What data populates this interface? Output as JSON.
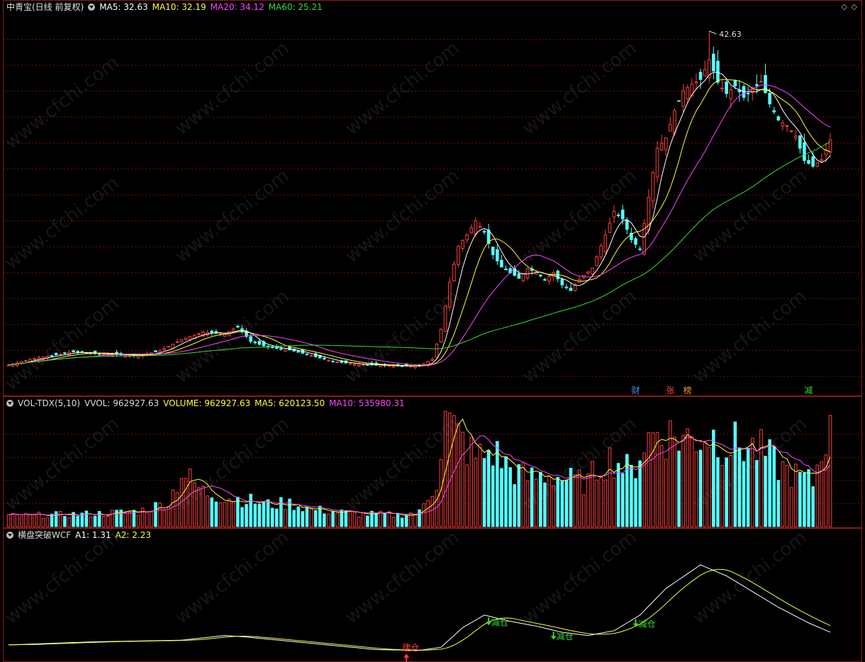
{
  "main": {
    "title": "中青宝(日线 前复权)",
    "ma5": {
      "label": "MA5: 32.63",
      "color": "#ffffff"
    },
    "ma10": {
      "label": "MA10: 32.19",
      "color": "#ffff33"
    },
    "ma20": {
      "label": "MA20: 34.12",
      "color": "#ff44ff"
    },
    "ma60": {
      "label": "MA60: 25.21",
      "color": "#33dd33"
    },
    "high_label": "42.63",
    "price_range": [
      6.0,
      44.5
    ],
    "events": [
      {
        "text": "财",
        "idx": 145,
        "color": "#4d8fff"
      },
      {
        "text": "张",
        "idx": 153,
        "color": "#ff4040"
      },
      {
        "text": "榜",
        "idx": 157,
        "color": "#e0a020"
      },
      {
        "text": "减",
        "idx": 185,
        "color": "#33dd33"
      }
    ]
  },
  "volume": {
    "title": "VOL-TDX(5,10)",
    "vvol": "VVOL: 962927.63",
    "volume": {
      "label": "VOLUME: 962927.63",
      "color": "#ffff33"
    },
    "ma5": {
      "label": "MA5: 620123.50",
      "color": "#ffff33"
    },
    "ma10": {
      "label": "MA10: 535980.31",
      "color": "#ff44ff"
    },
    "max": 1000000
  },
  "indicator": {
    "title": "横盘突破WCF",
    "a1": {
      "label": "A1: 1.31",
      "color": "#ffffff"
    },
    "a2": {
      "label": "A2: 2.23",
      "color": "#ffff33"
    },
    "signals": [
      {
        "text": "建仓",
        "idx": 92,
        "type": "buy"
      },
      {
        "text": "减仓",
        "idx": 111,
        "type": "sell"
      },
      {
        "text": "减仓",
        "idx": 126,
        "type": "sell"
      },
      {
        "text": "减仓",
        "idx": 145,
        "type": "sell"
      }
    ]
  },
  "watermark": "www.cfchi.com",
  "colors": {
    "up": "#ff3d3d",
    "down": "#54ffff",
    "grid": "#6e1010",
    "frame": "#8b1a1a"
  },
  "chart_data": {
    "type": "candlestick",
    "num_bars": 191,
    "anchors": [
      [
        0,
        7.2
      ],
      [
        5,
        7.8
      ],
      [
        10,
        8.2
      ],
      [
        15,
        8.6
      ],
      [
        20,
        8.4
      ],
      [
        25,
        8.3
      ],
      [
        30,
        8.2
      ],
      [
        35,
        8.7
      ],
      [
        40,
        9.9
      ],
      [
        45,
        10.7
      ],
      [
        50,
        10.5
      ],
      [
        53,
        11.3
      ],
      [
        56,
        9.7
      ],
      [
        60,
        9.1
      ],
      [
        65,
        8.8
      ],
      [
        70,
        8.2
      ],
      [
        75,
        7.6
      ],
      [
        80,
        7.3
      ],
      [
        85,
        7.2
      ],
      [
        90,
        7.1
      ],
      [
        95,
        7.1
      ],
      [
        98,
        7.8
      ],
      [
        100,
        11.0
      ],
      [
        102,
        16.0
      ],
      [
        104,
        19.8
      ],
      [
        106,
        21.0
      ],
      [
        108,
        22.5
      ],
      [
        110,
        21.3
      ],
      [
        112,
        18.9
      ],
      [
        114,
        17.6
      ],
      [
        116,
        17.0
      ],
      [
        118,
        16.4
      ],
      [
        120,
        17.4
      ],
      [
        122,
        17.1
      ],
      [
        124,
        16.2
      ],
      [
        126,
        17.0
      ],
      [
        128,
        15.7
      ],
      [
        130,
        15.1
      ],
      [
        132,
        16.3
      ],
      [
        135,
        17.5
      ],
      [
        138,
        21.0
      ],
      [
        140,
        23.5
      ],
      [
        142,
        22.7
      ],
      [
        144,
        20.5
      ],
      [
        146,
        19.5
      ],
      [
        148,
        25.0
      ],
      [
        150,
        30.2
      ],
      [
        152,
        31.3
      ],
      [
        154,
        34.2
      ],
      [
        156,
        36.3
      ],
      [
        158,
        37.0
      ],
      [
        160,
        37.5
      ],
      [
        162,
        39.6
      ],
      [
        164,
        37.2
      ],
      [
        166,
        36.0
      ],
      [
        168,
        36.8
      ],
      [
        170,
        35.6
      ],
      [
        172,
        36.4
      ],
      [
        174,
        37.3
      ],
      [
        176,
        34.9
      ],
      [
        178,
        33.2
      ],
      [
        180,
        32.6
      ],
      [
        182,
        31.5
      ],
      [
        184,
        28.9
      ],
      [
        186,
        28.3
      ],
      [
        188,
        29.0
      ],
      [
        190,
        31.1
      ]
    ],
    "ma60_end": 30.9,
    "volume_anchors": [
      [
        0,
        90000
      ],
      [
        10,
        100000
      ],
      [
        20,
        110000
      ],
      [
        30,
        130000
      ],
      [
        37,
        210000
      ],
      [
        40,
        470000
      ],
      [
        45,
        300000
      ],
      [
        50,
        260000
      ],
      [
        55,
        230000
      ],
      [
        60,
        190000
      ],
      [
        65,
        200000
      ],
      [
        70,
        150000
      ],
      [
        80,
        110000
      ],
      [
        90,
        100000
      ],
      [
        95,
        120000
      ],
      [
        99,
        400000
      ],
      [
        101,
        920000
      ],
      [
        104,
        780000
      ],
      [
        108,
        590000
      ],
      [
        112,
        650000
      ],
      [
        116,
        500000
      ],
      [
        120,
        420000
      ],
      [
        125,
        450000
      ],
      [
        130,
        400000
      ],
      [
        134,
        380000
      ],
      [
        137,
        560000
      ],
      [
        140,
        590000
      ],
      [
        144,
        460000
      ],
      [
        147,
        730000
      ],
      [
        150,
        820000
      ],
      [
        154,
        780000
      ],
      [
        158,
        760000
      ],
      [
        162,
        800000
      ],
      [
        166,
        720000
      ],
      [
        170,
        700000
      ],
      [
        174,
        650000
      ],
      [
        178,
        520000
      ],
      [
        182,
        440000
      ],
      [
        186,
        380000
      ],
      [
        190,
        962927
      ]
    ],
    "indicator_anchors": [
      [
        0,
        0.5
      ],
      [
        20,
        0.7
      ],
      [
        40,
        0.8
      ],
      [
        50,
        1.1
      ],
      [
        55,
        1.0
      ],
      [
        70,
        0.6
      ],
      [
        85,
        0.2
      ],
      [
        95,
        0.15
      ],
      [
        100,
        0.35
      ],
      [
        105,
        1.6
      ],
      [
        110,
        2.4
      ],
      [
        116,
        2.0
      ],
      [
        122,
        1.7
      ],
      [
        128,
        1.3
      ],
      [
        134,
        1.1
      ],
      [
        140,
        1.4
      ],
      [
        146,
        2.4
      ],
      [
        152,
        4.1
      ],
      [
        160,
        5.6
      ],
      [
        166,
        4.9
      ],
      [
        172,
        3.9
      ],
      [
        178,
        2.9
      ],
      [
        185,
        1.9
      ],
      [
        190,
        1.31
      ]
    ],
    "indicator_range": [
      -0.5,
      7.0
    ]
  }
}
